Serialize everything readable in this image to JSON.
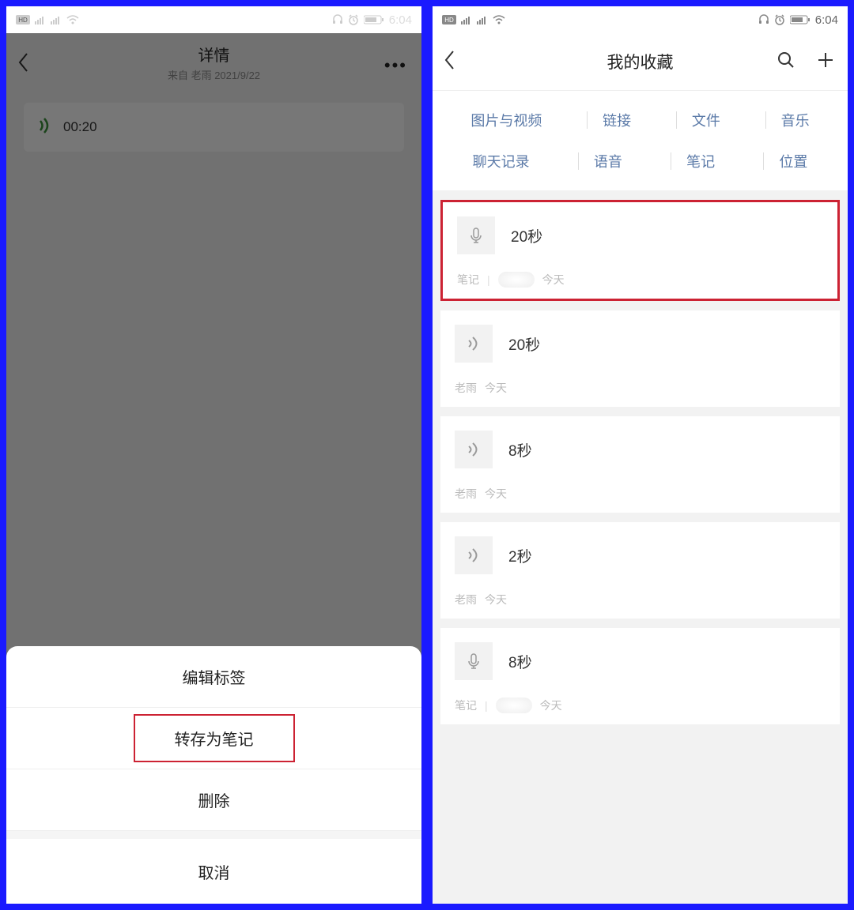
{
  "statusbar": {
    "time": "6:04"
  },
  "left": {
    "header": {
      "title": "详情",
      "subtitle": "来自 老雨 2021/9/22"
    },
    "voice": {
      "duration": "00:20"
    },
    "sheet": {
      "edit_tags": "编辑标签",
      "save_as_note": "转存为笔记",
      "delete": "删除",
      "cancel": "取消"
    }
  },
  "right": {
    "header": {
      "title": "我的收藏"
    },
    "categories": {
      "row1": [
        "图片与视频",
        "链接",
        "文件",
        "音乐"
      ],
      "row2": [
        "聊天记录",
        "语音",
        "笔记",
        "位置"
      ]
    },
    "items": [
      {
        "icon": "mic",
        "duration": "20秒",
        "meta_left": "笔记",
        "meta_right": "今天",
        "blur": true,
        "hl": true
      },
      {
        "icon": "sound",
        "duration": "20秒",
        "meta_left": "老雨",
        "meta_right": "今天",
        "blur": false,
        "hl": false
      },
      {
        "icon": "sound",
        "duration": "8秒",
        "meta_left": "老雨",
        "meta_right": "今天",
        "blur": false,
        "hl": false
      },
      {
        "icon": "sound",
        "duration": "2秒",
        "meta_left": "老雨",
        "meta_right": "今天",
        "blur": false,
        "hl": false
      },
      {
        "icon": "mic",
        "duration": "8秒",
        "meta_left": "笔记",
        "meta_right": "今天",
        "blur": true,
        "hl": false
      }
    ]
  }
}
